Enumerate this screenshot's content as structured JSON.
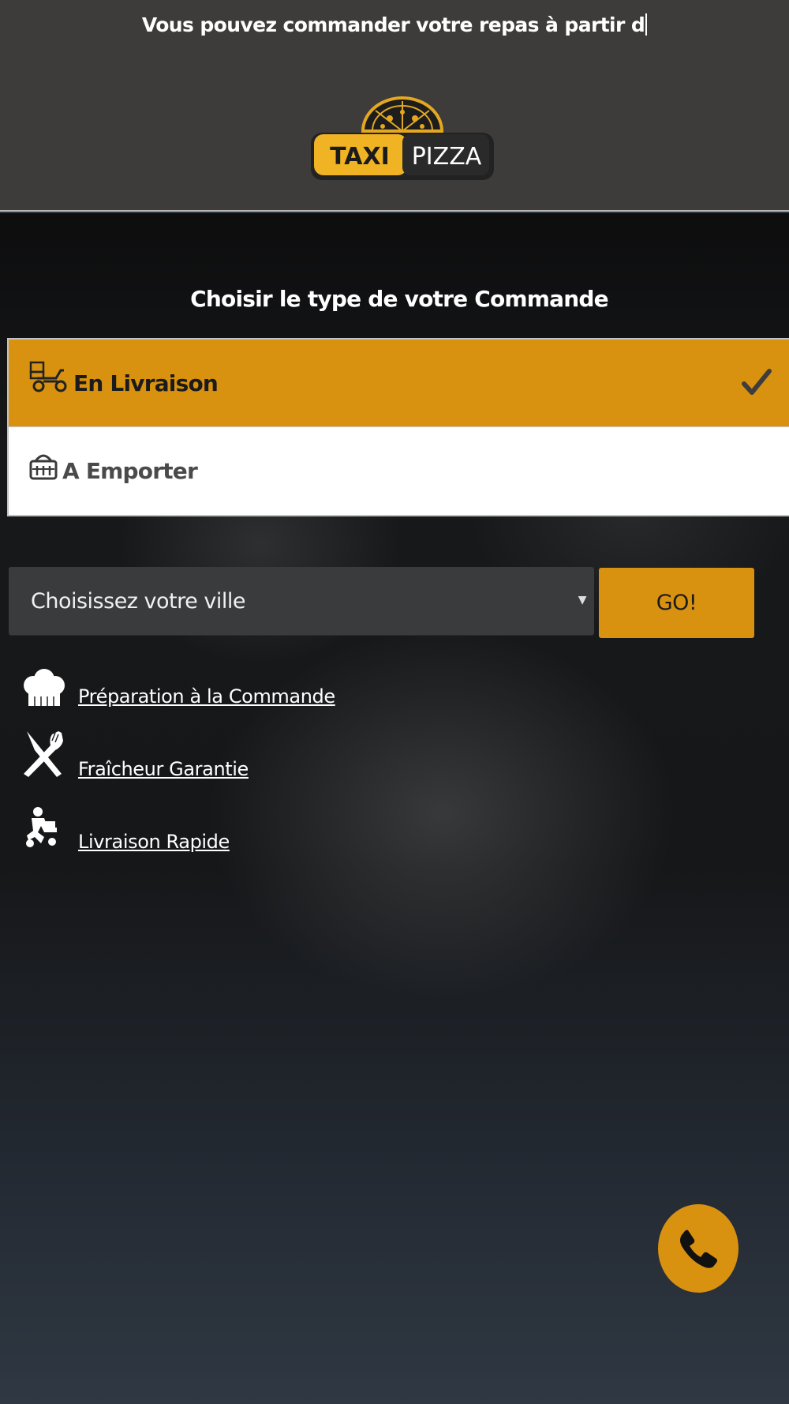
{
  "header": {
    "ticker_text": "Vous pouvez commander votre repas à partir d",
    "logo": {
      "word_left": "TAXI",
      "word_right": "PIZZA"
    }
  },
  "order": {
    "title": "Choisir le type de votre Commande",
    "options": [
      {
        "label": "En Livraison",
        "icon": "scooter-icon",
        "selected": true
      },
      {
        "label": "A Emporter",
        "icon": "basket-icon",
        "selected": false
      }
    ]
  },
  "city": {
    "placeholder": "Choisissez votre ville",
    "go_label": "GO!"
  },
  "features": [
    {
      "label": "Préparation à la Commande",
      "icon": "chef-hat-icon"
    },
    {
      "label": "Fraîcheur Garantie",
      "icon": "knife-fork-icon"
    },
    {
      "label": "Livraison Rapide",
      "icon": "delivery-man-icon"
    }
  ],
  "colors": {
    "accent": "#d8920f",
    "header_bg": "#3d3c3a",
    "page_bottom": "#2f3843"
  }
}
